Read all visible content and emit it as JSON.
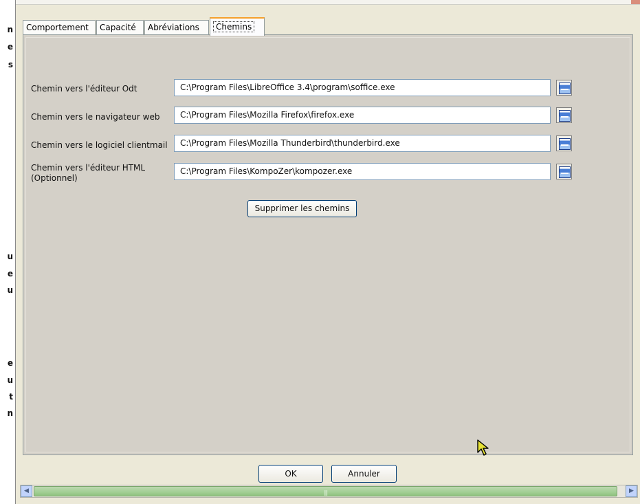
{
  "background_doc": {
    "fragments": [
      "n",
      "e",
      "s",
      "u",
      "e",
      "u",
      "e",
      "u",
      "t",
      "n"
    ]
  },
  "tabs": [
    {
      "label": "Comportement",
      "active": false
    },
    {
      "label": "Capacité",
      "active": false
    },
    {
      "label": "Abréviations",
      "active": false
    },
    {
      "label": "Chemins",
      "active": true
    }
  ],
  "paths": [
    {
      "label": "Chemin vers l'éditeur Odt",
      "value": "C:\\Program Files\\LibreOffice 3.4\\program\\soffice.exe",
      "icon": "browse-folder-icon"
    },
    {
      "label": "Chemin vers le navigateur web",
      "value": "C:\\Program Files\\Mozilla Firefox\\firefox.exe",
      "icon": "browse-folder-icon"
    },
    {
      "label": "Chemin vers le logiciel clientmail",
      "value": "C:\\Program Files\\Mozilla Thunderbird\\thunderbird.exe",
      "icon": "browse-folder-icon"
    },
    {
      "label": "Chemin vers l'éditeur HTML (Optionnel)",
      "value": "C:\\Program Files\\KompoZer\\kompozer.exe",
      "icon": "browse-folder-icon"
    }
  ],
  "clear_button": "Supprimer les chemins",
  "footer": {
    "ok": "OK",
    "cancel": "Annuler"
  },
  "scrollbar": {
    "grip": "|||"
  },
  "colors": {
    "active_tab_accent": "#f5a02c",
    "panel_bg": "#d4d0c8",
    "dialog_bg": "#ece9d8"
  }
}
